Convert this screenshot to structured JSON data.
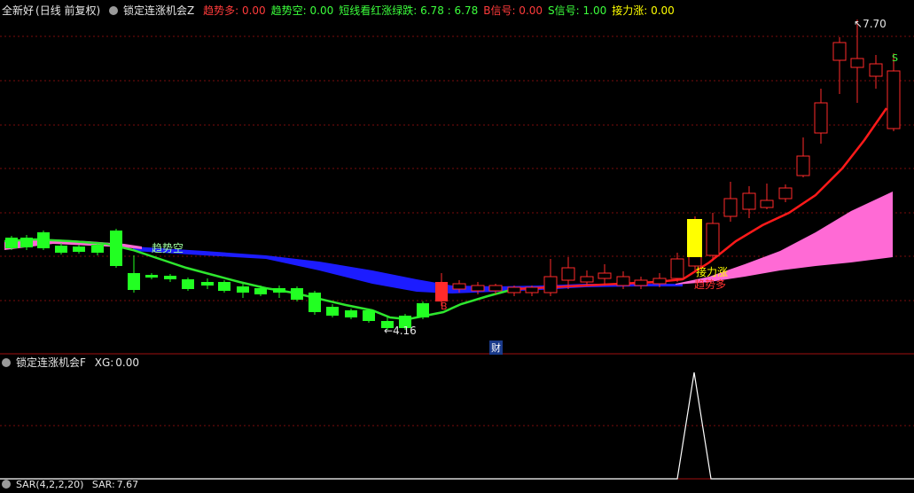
{
  "header": {
    "stock_name": "全新好",
    "period": "(日线 前复权)",
    "indicator_name": "锁定连涨机会Z",
    "values": [
      {
        "label": "趋势多:",
        "value": "0.00",
        "color": "#ff3b3b"
      },
      {
        "label": "趋势空:",
        "value": "0.00",
        "color": "#3cff3c"
      },
      {
        "label": "短线看红涨绿跌:",
        "value": "6.78",
        "extra": ": 6.78",
        "color": "#3cff3c"
      },
      {
        "label": "B信号:",
        "value": "0.00",
        "color": "#ff3b3b"
      },
      {
        "label": "S信号:",
        "value": "1.00",
        "color": "#3cff3c"
      },
      {
        "label": "接力涨:",
        "value": "0.00",
        "color": "#ffff00"
      }
    ]
  },
  "main_chart": {
    "high_label": "7.70",
    "low_label": "4.16",
    "trend_short_label": "趋势空",
    "trend_long_label": "趋势多",
    "relay_label": "接力涨",
    "buy_marker": "B",
    "sell_marker": "S",
    "finance_marker": "财",
    "colors": {
      "up": "#ff2a2a",
      "down": "#22ff22",
      "bear_band": "#1a1aff",
      "bull_band": "#ff6ad5",
      "grid": "#8a1010"
    }
  },
  "sub_panel": {
    "indicator_name": "锁定连涨机会F",
    "xg_label": "XG:",
    "xg_value": "0.00"
  },
  "bottom_panel": {
    "label": "SAR(4,2,2,20)",
    "value_label": "SAR:",
    "value": "7.67"
  }
}
